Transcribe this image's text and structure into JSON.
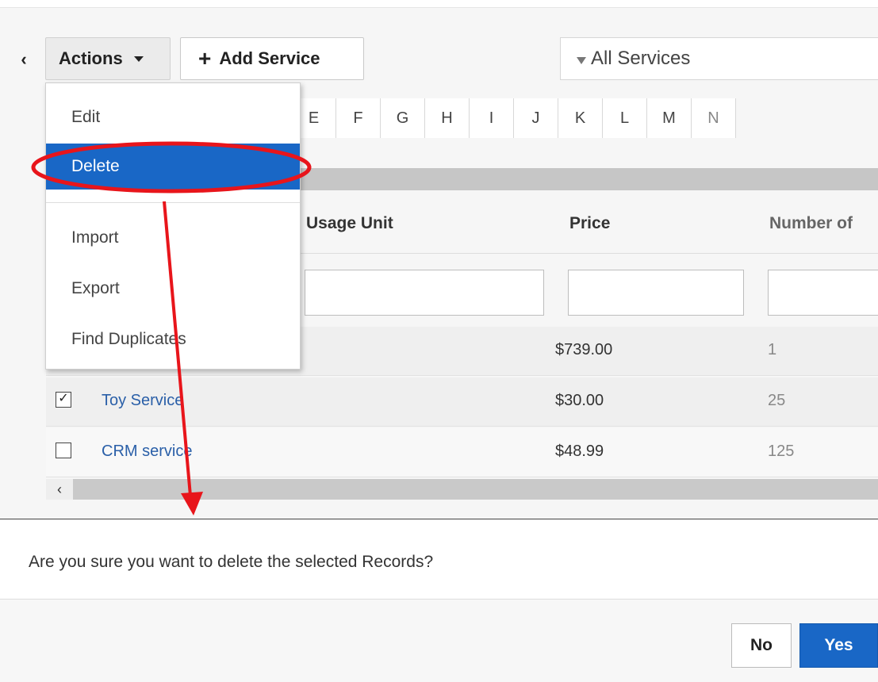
{
  "toolbar": {
    "collapse_icon": "chevron-left-icon",
    "actions_label": "Actions",
    "add_service_label": "Add Service",
    "filter_label": "All Services"
  },
  "alphabet": [
    "E",
    "F",
    "G",
    "H",
    "I",
    "J",
    "K",
    "L",
    "M",
    "N"
  ],
  "actions_menu": {
    "items": [
      "Edit",
      "Delete",
      "Import",
      "Export",
      "Find Duplicates"
    ],
    "active_item": "Delete"
  },
  "table": {
    "columns": [
      "Usage Unit",
      "Price",
      "Number of"
    ],
    "rows": [
      {
        "name": "",
        "price": "$739.00",
        "qty": "1",
        "checked": false
      },
      {
        "name": "Toy Service",
        "price": "$30.00",
        "qty": "25",
        "checked": true
      },
      {
        "name": "CRM service",
        "price": "$48.99",
        "qty": "125",
        "checked": false
      }
    ]
  },
  "dialog": {
    "message": "Are you sure you want to delete the selected Records?",
    "no_label": "No",
    "yes_label": "Yes"
  },
  "annotation": {
    "color": "#e8151b"
  }
}
